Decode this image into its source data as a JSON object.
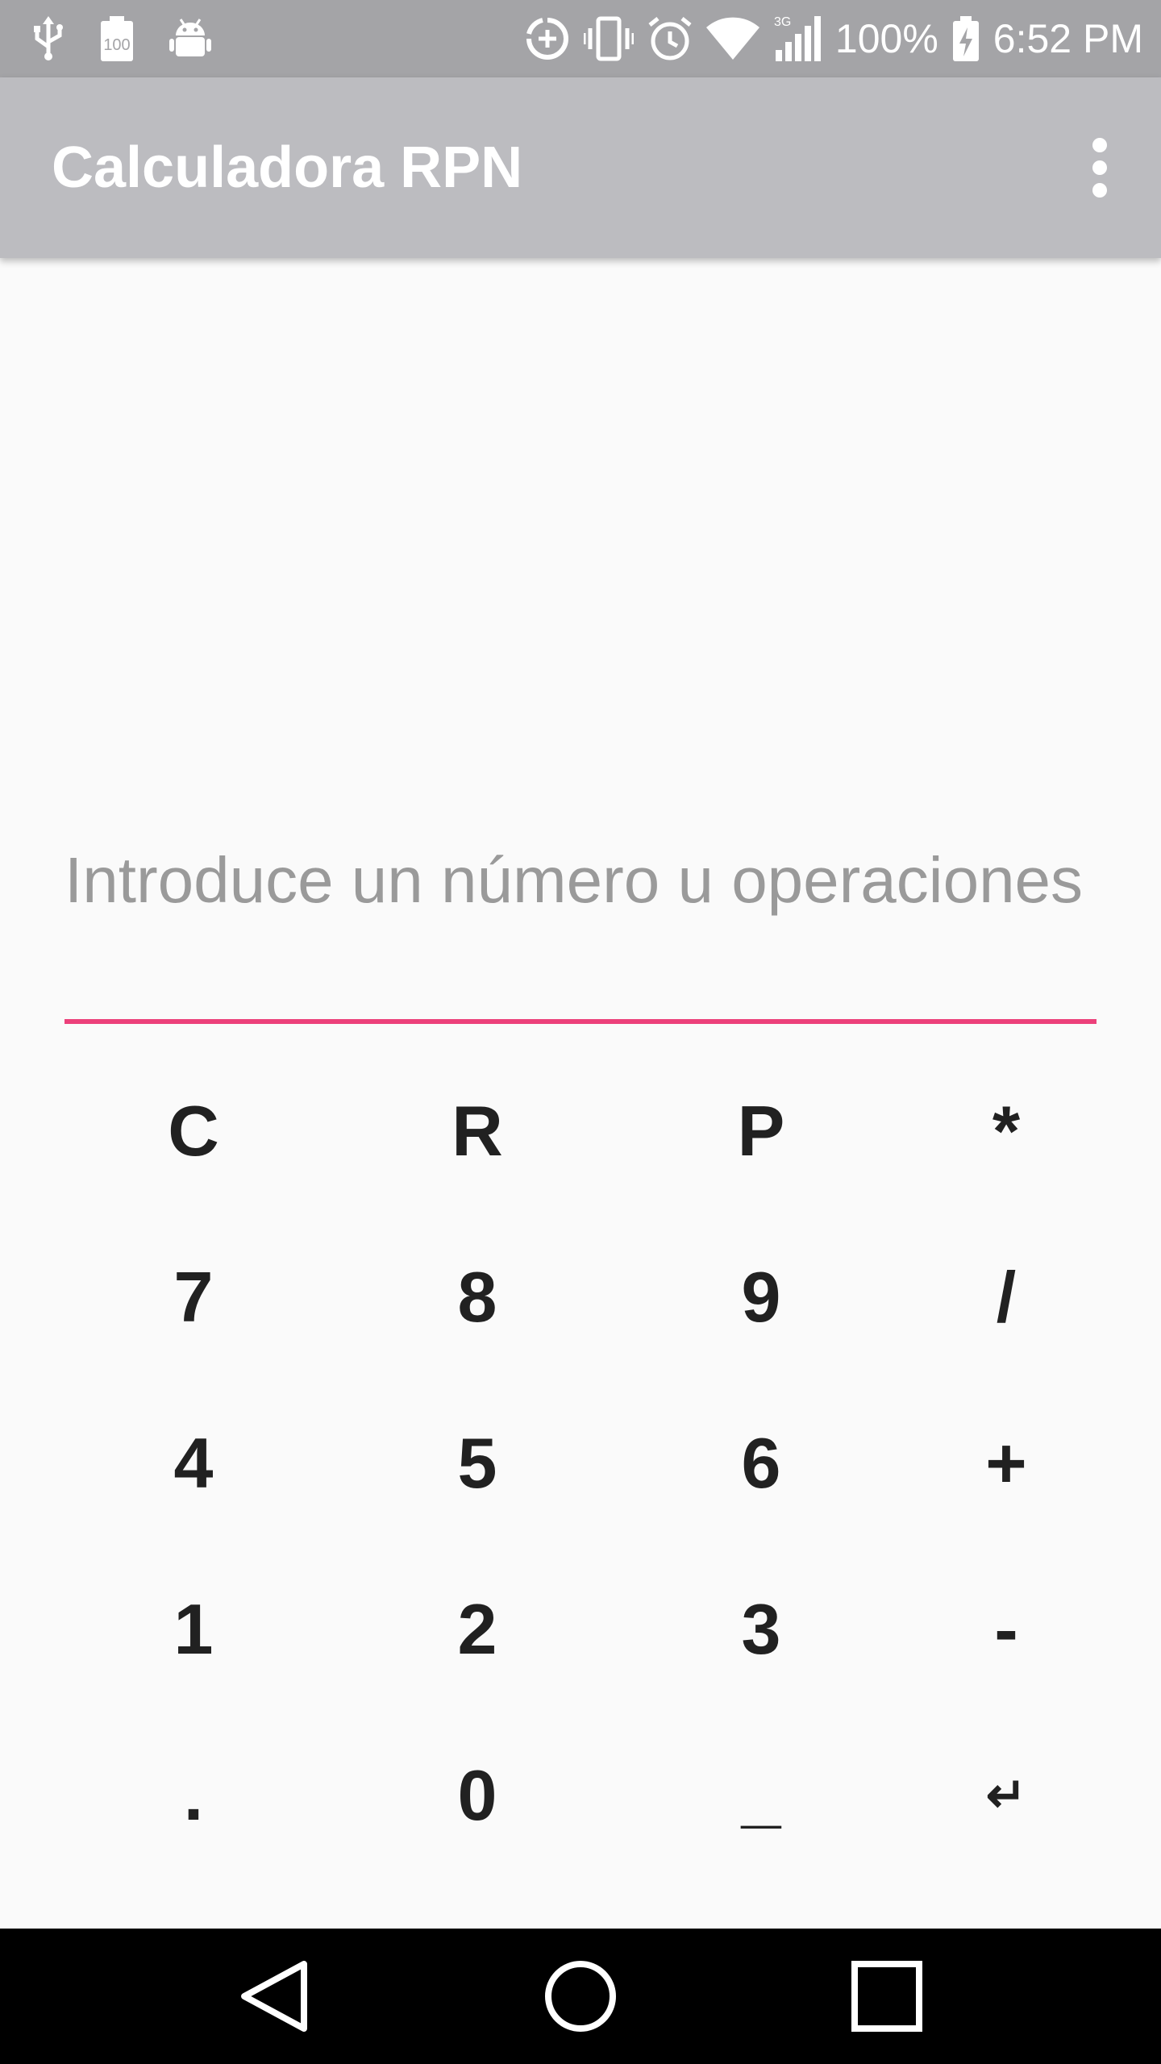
{
  "status_bar": {
    "battery_percent": "100%",
    "time": "6:52 PM",
    "network_label": "3G",
    "left_icons": [
      "usb-icon",
      "battery-100-icon",
      "android-debug-icon"
    ],
    "right_icons": [
      "data-saver-icon",
      "vibrate-icon",
      "alarm-icon",
      "wifi-icon",
      "cell-signal-icon",
      "battery-charging-icon"
    ]
  },
  "app_bar": {
    "title": "Calculadora RPN",
    "menu_icon": "more-vertical-icon"
  },
  "input": {
    "placeholder": "Introduce un número u operaciones",
    "value": "",
    "accent_color": "#ec407a"
  },
  "keypad": {
    "rows": [
      [
        "C",
        "R",
        "P",
        "*"
      ],
      [
        "7",
        "8",
        "9",
        "/"
      ],
      [
        "4",
        "5",
        "6",
        "+"
      ],
      [
        "1",
        "2",
        "3",
        "-"
      ],
      [
        ".",
        "0",
        "_",
        "↵"
      ]
    ]
  },
  "nav_bar": {
    "icons": [
      "back-icon",
      "home-icon",
      "recents-icon"
    ]
  },
  "colors": {
    "status_bar_bg": "#a4a4a7",
    "app_bar_bg": "#bcbcc0",
    "background": "#fafafa",
    "key_text": "#212121"
  }
}
